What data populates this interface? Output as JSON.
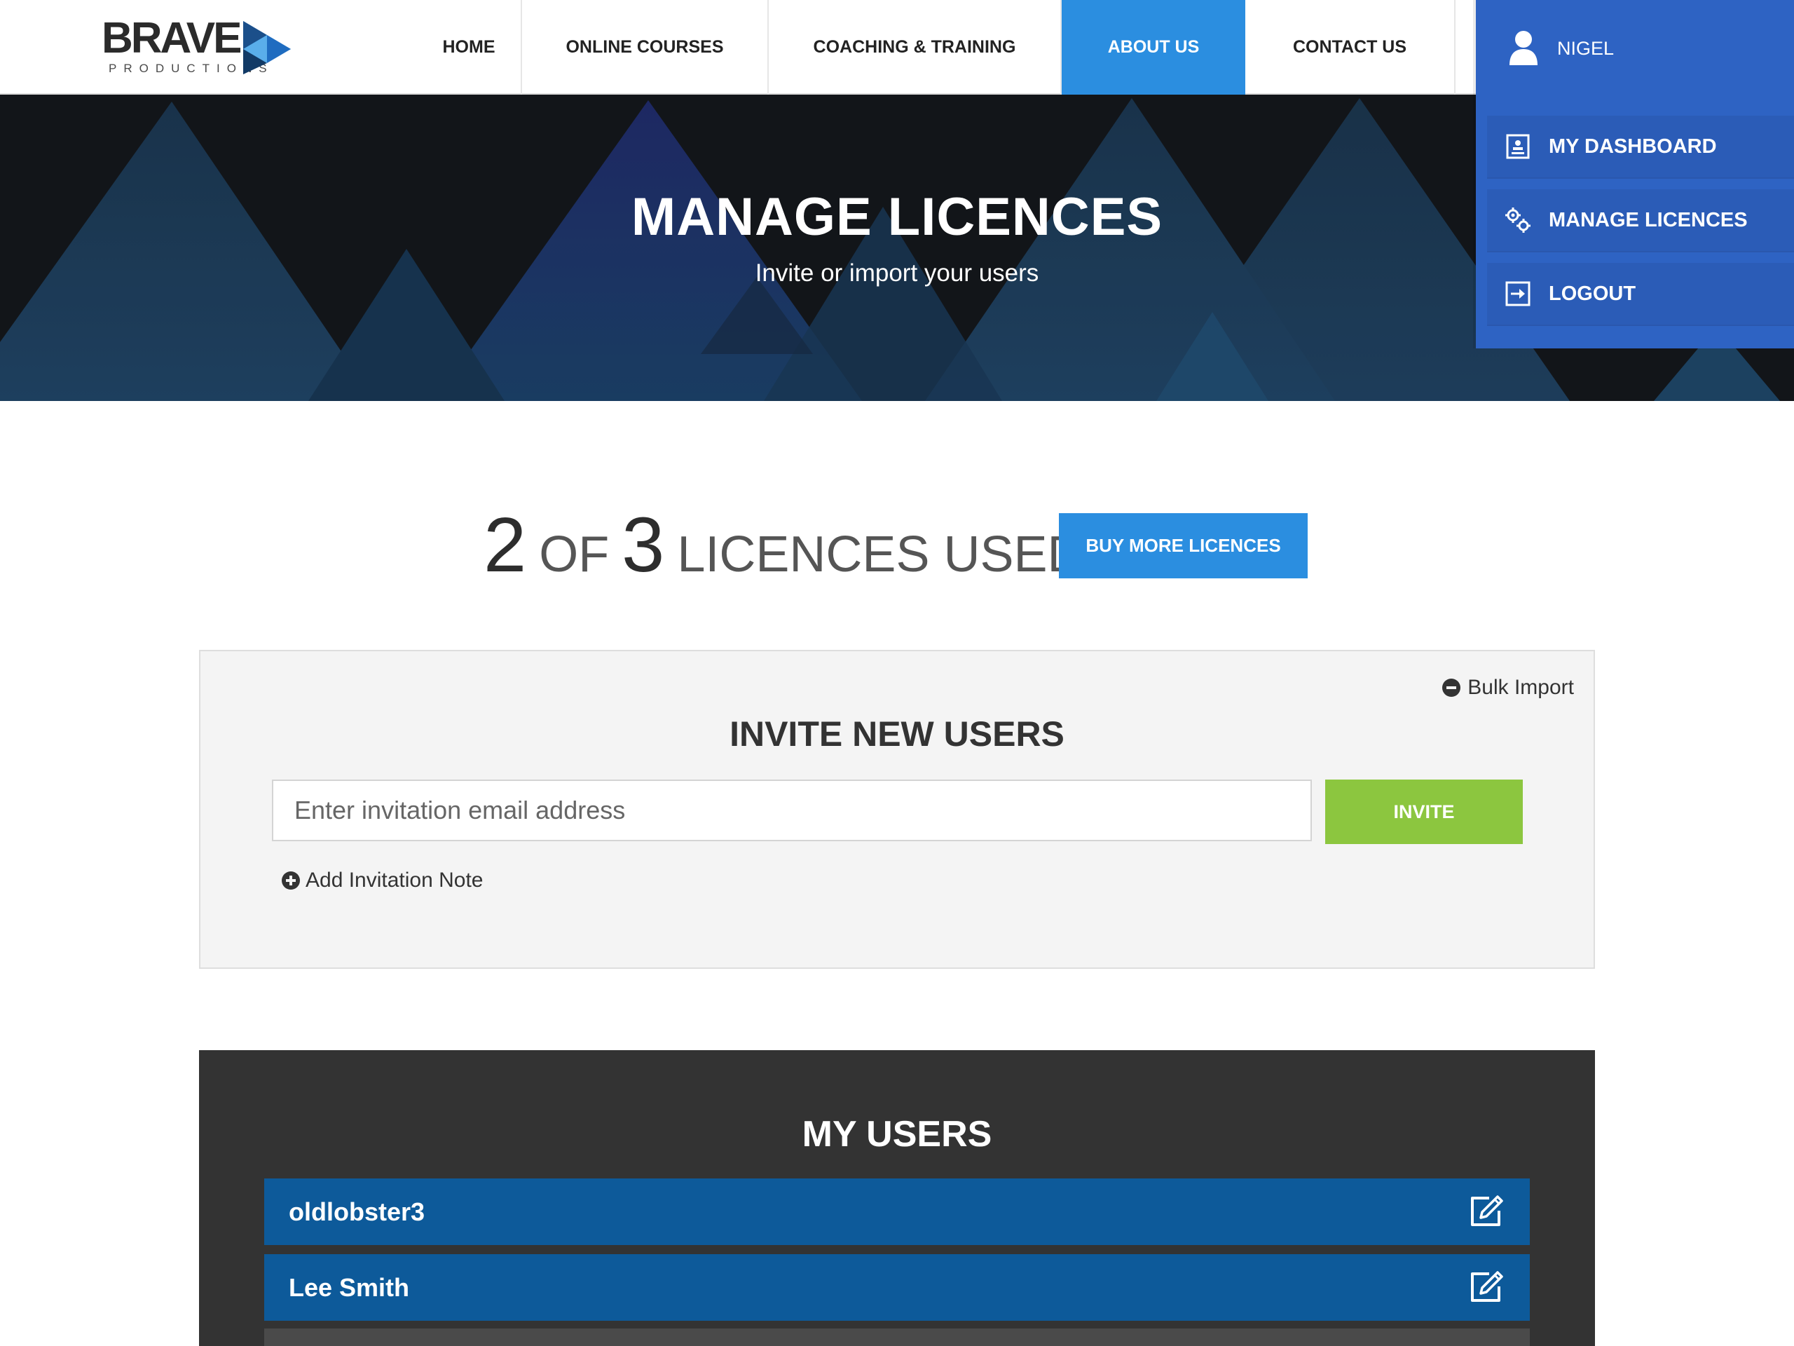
{
  "brand": {
    "wordmark": "BRAVE",
    "tagline": "PRODUCTIONS",
    "colors": {
      "primary": "#2b8ee0",
      "menu": "#2e63c3",
      "success": "#8cc63f",
      "row": "#0d5a9a"
    }
  },
  "nav": {
    "items": [
      {
        "label": "HOME",
        "active": false
      },
      {
        "label": "ONLINE COURSES",
        "active": false
      },
      {
        "label": "COACHING & TRAINING",
        "active": false
      },
      {
        "label": "ABOUT US",
        "active": true
      },
      {
        "label": "CONTACT US",
        "active": false
      }
    ]
  },
  "user_menu": {
    "name": "NIGEL",
    "icon": "user-icon",
    "items": [
      {
        "label": "MY DASHBOARD",
        "icon": "dashboard-icon"
      },
      {
        "label": "MANAGE LICENCES",
        "icon": "gears-icon"
      },
      {
        "label": "LOGOUT",
        "icon": "logout-icon"
      }
    ]
  },
  "hero": {
    "title": "MANAGE LICENCES",
    "subtitle": "Invite or import your users"
  },
  "licences": {
    "used": "2",
    "of_word": "OF",
    "total": "3",
    "suffix": "LICENCES USED",
    "buy_label": "BUY MORE LICENCES"
  },
  "invite": {
    "bulk_label": "Bulk Import",
    "title": "INVITE NEW USERS",
    "email_placeholder": "Enter invitation email address",
    "invite_label": "INVITE",
    "note_label": "Add Invitation Note"
  },
  "users": {
    "title": "MY USERS",
    "rows": [
      {
        "name": "oldlobster3",
        "icon": "edit-icon"
      },
      {
        "name": "Lee Smith",
        "icon": "edit-icon"
      }
    ]
  }
}
